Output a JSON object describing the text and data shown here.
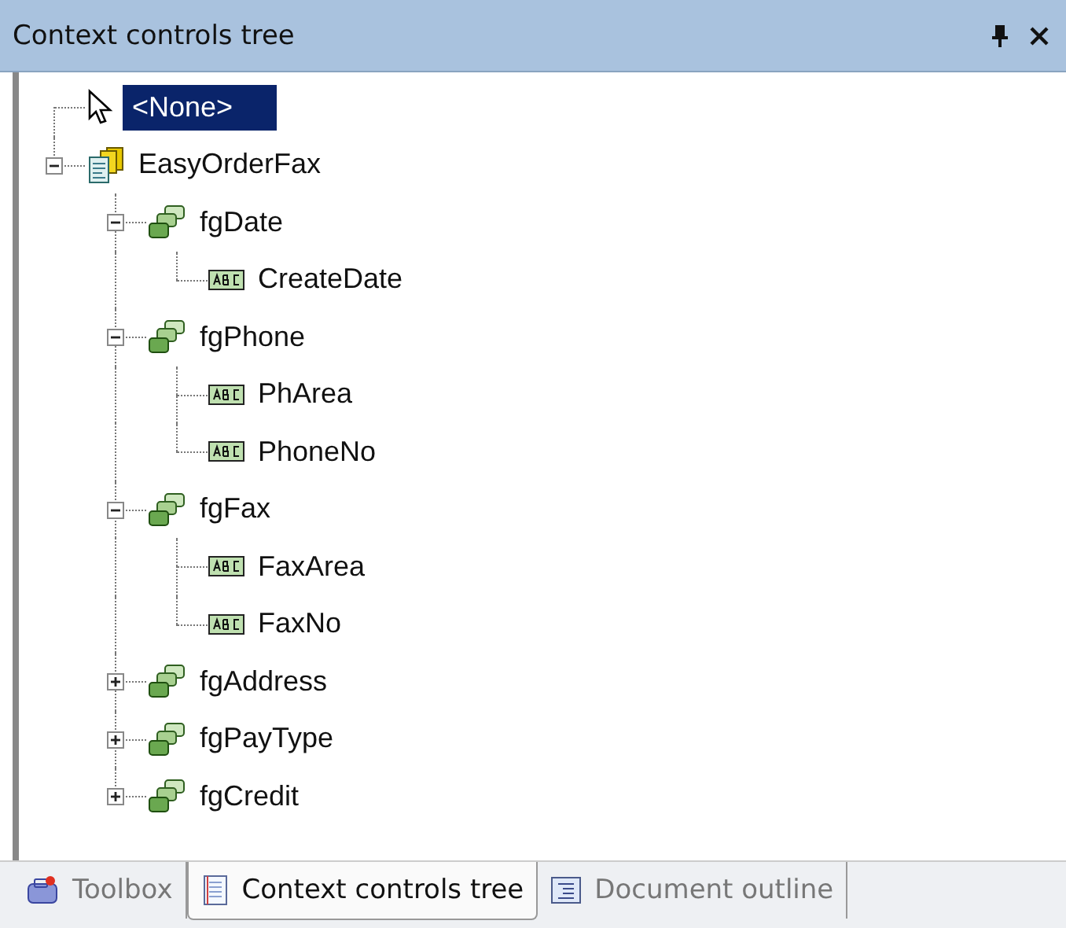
{
  "panel": {
    "title": "Context controls tree"
  },
  "tree": [
    {
      "label": "<None>",
      "kind": "pointer",
      "selected": true
    },
    {
      "label": "EasyOrderFax",
      "kind": "form",
      "selected": false,
      "expanded": true,
      "children": [
        {
          "label": "fgDate",
          "kind": "group",
          "selected": false,
          "expanded": true,
          "children": [
            {
              "label": "CreateDate",
              "kind": "field",
              "selected": false
            }
          ]
        },
        {
          "label": "fgPhone",
          "kind": "group",
          "selected": false,
          "expanded": true,
          "children": [
            {
              "label": "PhArea",
              "kind": "field",
              "selected": false
            },
            {
              "label": "PhoneNo",
              "kind": "field",
              "selected": false
            }
          ]
        },
        {
          "label": "fgFax",
          "kind": "group",
          "selected": false,
          "expanded": true,
          "children": [
            {
              "label": "FaxArea",
              "kind": "field",
              "selected": false
            },
            {
              "label": "FaxNo",
              "kind": "field",
              "selected": false
            }
          ]
        },
        {
          "label": "fgAddress",
          "kind": "group",
          "selected": false,
          "expanded": false
        },
        {
          "label": "fgPayType",
          "kind": "group",
          "selected": false,
          "expanded": false
        },
        {
          "label": "fgCredit",
          "kind": "group",
          "selected": false,
          "expanded": false
        }
      ]
    }
  ],
  "tabs": [
    {
      "label": "Toolbox",
      "kind": "toolbox",
      "selected": false
    },
    {
      "label": "Context controls tree",
      "kind": "tree",
      "selected": true
    },
    {
      "label": "Document outline",
      "kind": "outline",
      "selected": false
    }
  ]
}
